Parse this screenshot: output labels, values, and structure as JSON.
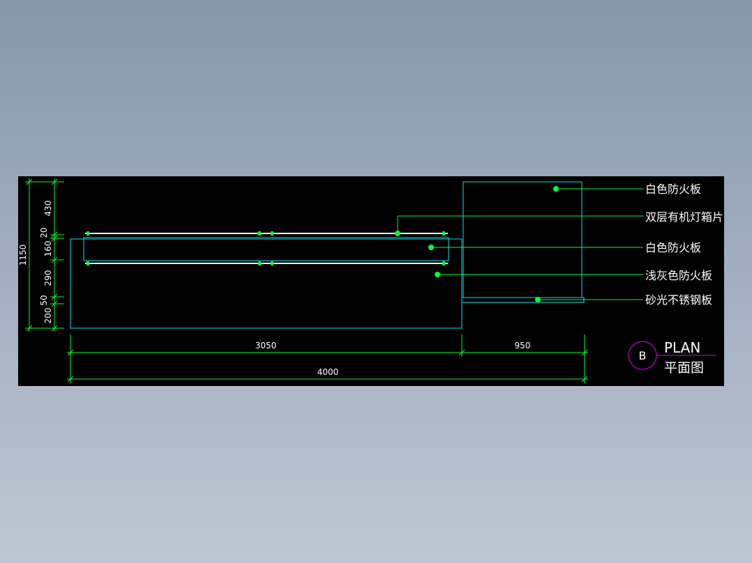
{
  "drawing": {
    "title_mark": "B",
    "title_en": "PLAN",
    "title_cn": "平面图"
  },
  "callouts": [
    {
      "text": "白色防火板"
    },
    {
      "text": "双层有机灯箱片"
    },
    {
      "text": "白色防火板"
    },
    {
      "text": "浅灰色防火板"
    },
    {
      "text": "砂光不锈钢板"
    }
  ],
  "dimensions": {
    "horizontal": [
      "3050",
      "950",
      "4000"
    ],
    "vertical_total": "1150",
    "vertical_parts": [
      "430",
      "20",
      "160",
      "290",
      "50",
      "200"
    ]
  },
  "colors": {
    "background": "#000000",
    "outline": "#00e5ee",
    "dimension": "#00ff33",
    "leader": "#00ff33",
    "text": "#ffffff",
    "title_circle": "#e000e0"
  }
}
